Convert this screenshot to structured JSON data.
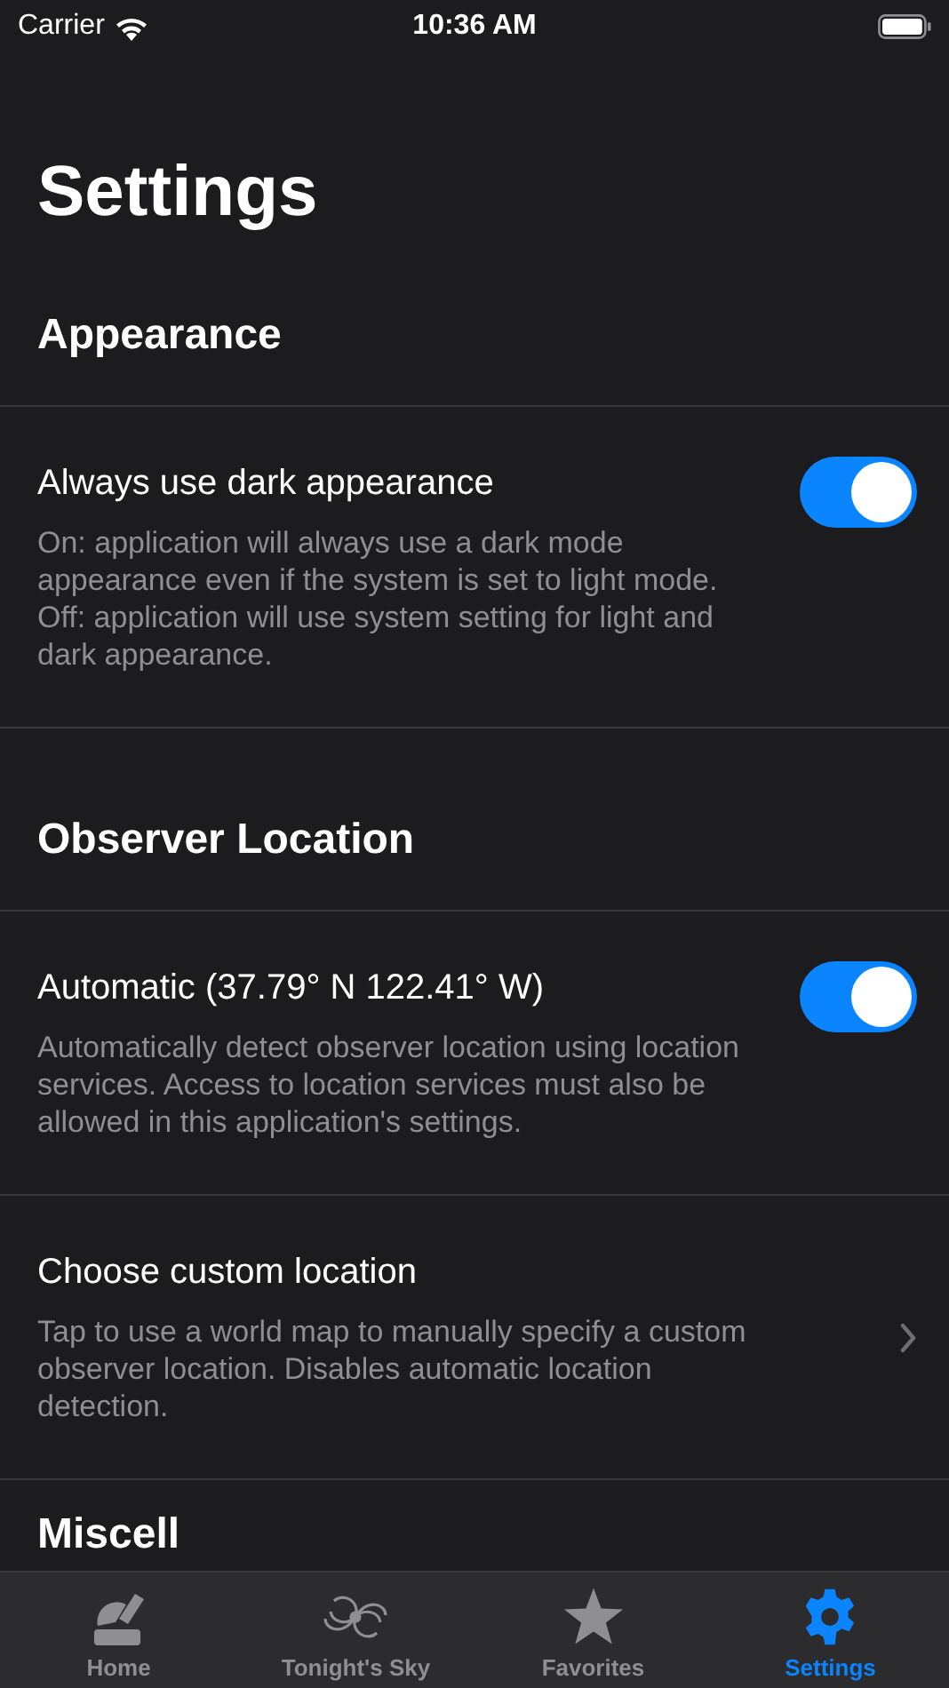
{
  "status_bar": {
    "carrier": "Carrier",
    "time": "10:36 AM"
  },
  "title": "Settings",
  "sections": [
    {
      "heading": "Appearance",
      "rows": [
        {
          "kind": "toggle",
          "title": "Always use dark appearance",
          "description": "On: application will always use a dark mode appearance even if the system is set to light mode. Off: application will use system setting for light and dark appearance.",
          "on": true
        }
      ]
    },
    {
      "heading": "Observer Location",
      "rows": [
        {
          "kind": "toggle",
          "title": "Automatic (37.79° N 122.41° W)",
          "description": "Automatically detect observer location using location services. Access to location services must also be allowed in this application's settings.",
          "on": true
        },
        {
          "kind": "link",
          "title": "Choose custom location",
          "description": "Tap to use a world map to manually specify a custom observer location. Disables automatic location detection."
        }
      ]
    },
    {
      "heading": "Miscell"
    }
  ],
  "tab_bar": [
    {
      "label": "Home",
      "selected": false
    },
    {
      "label": "Tonight's Sky",
      "selected": false
    },
    {
      "label": "Favorites",
      "selected": false
    },
    {
      "label": "Settings",
      "selected": true
    }
  ]
}
